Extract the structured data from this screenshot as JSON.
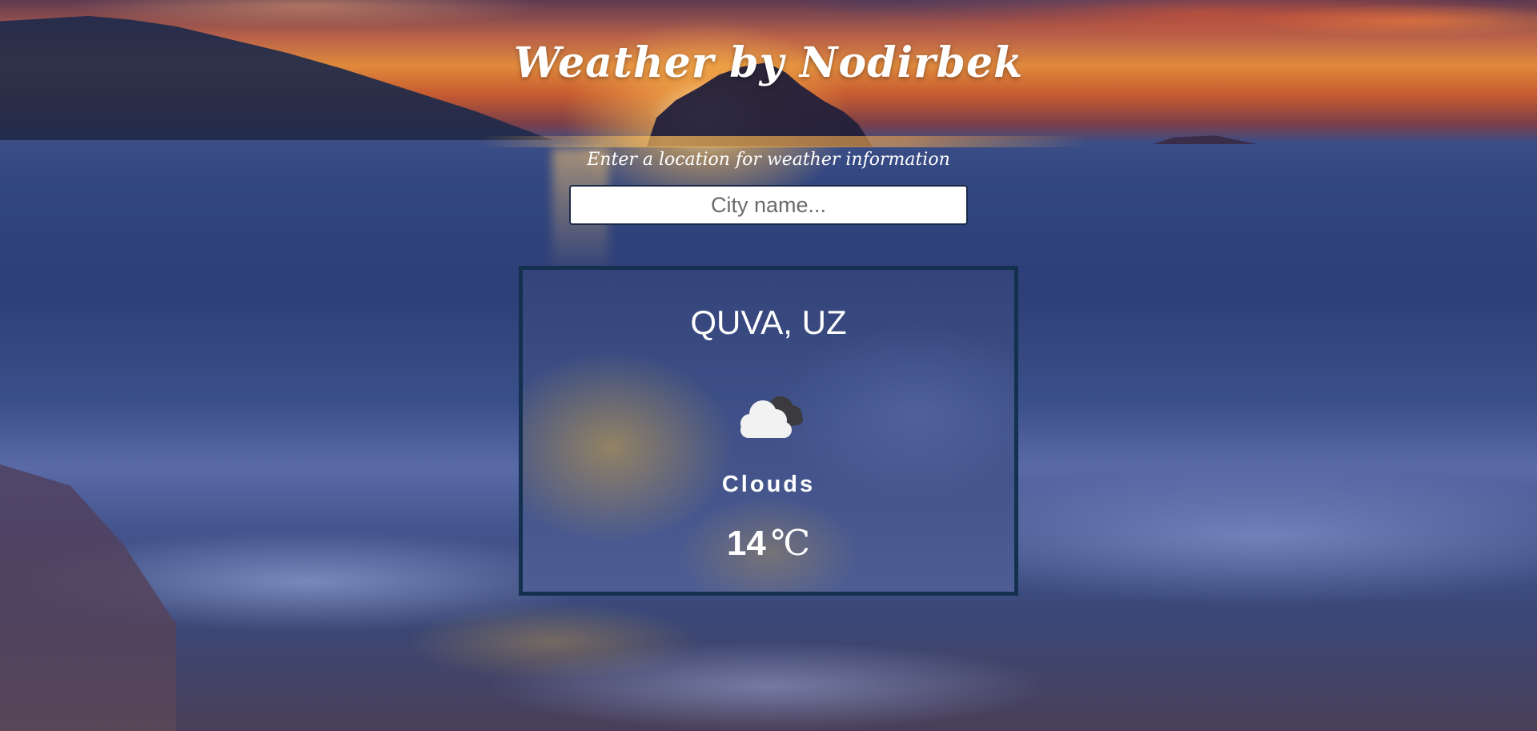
{
  "header": {
    "title": "Weather by Nodirbek",
    "subtitle": "Enter a location for weather information"
  },
  "search": {
    "placeholder": "City name...",
    "value": ""
  },
  "weather": {
    "location": "QUVA, UZ",
    "icon": "clouds-icon",
    "condition": "Clouds",
    "temperature": "14",
    "unit": "℃"
  },
  "colors": {
    "card_border": "#13304f",
    "input_border": "#1c2a4a",
    "text": "#ffffff"
  }
}
